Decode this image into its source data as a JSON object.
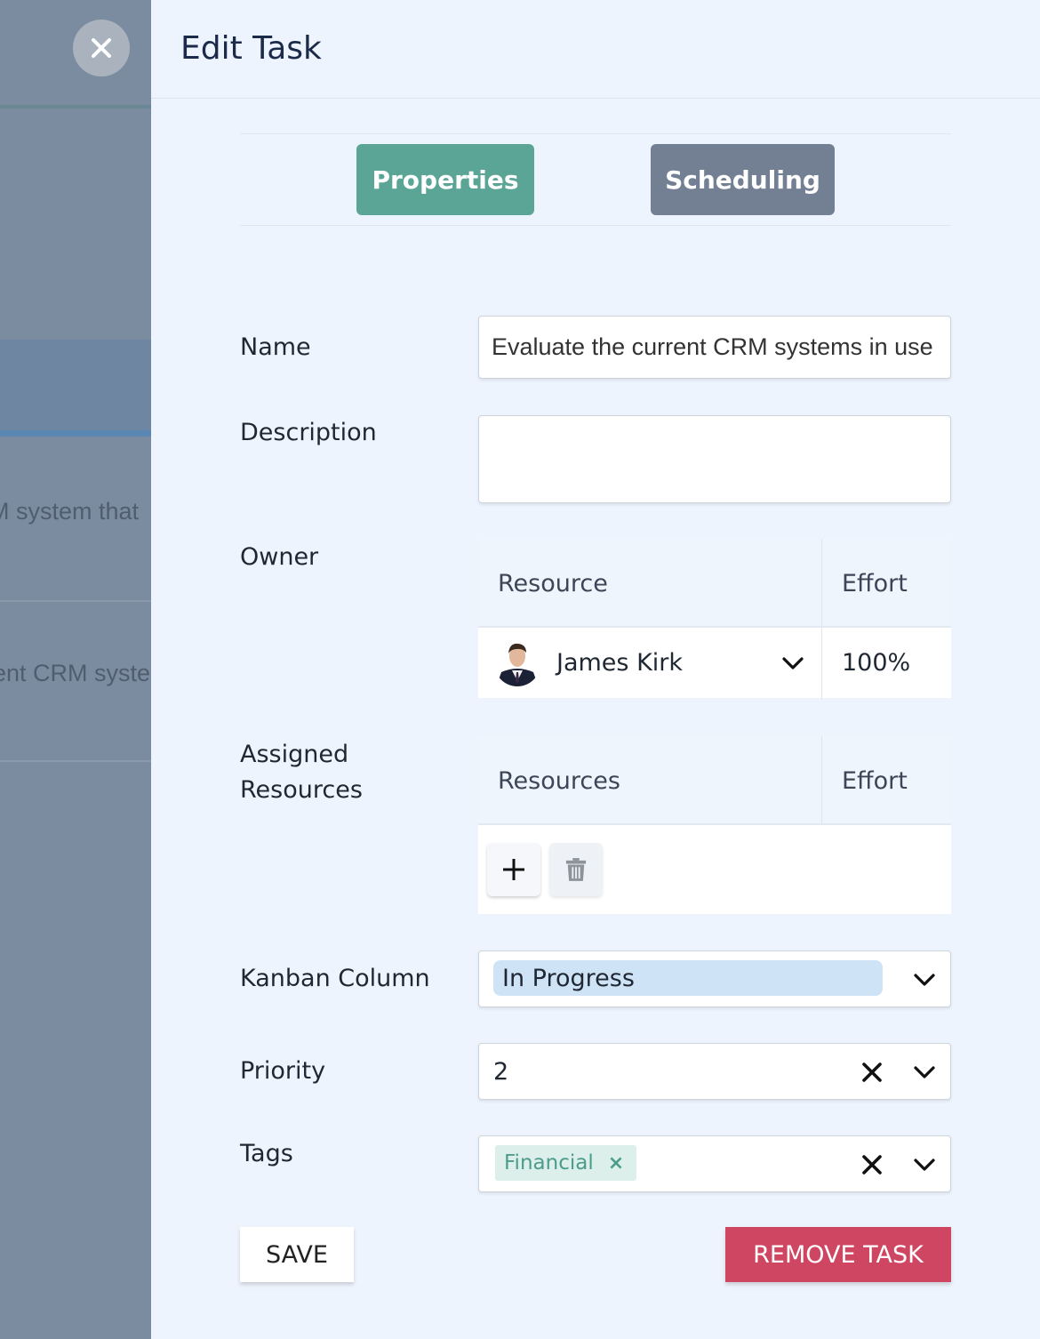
{
  "background": {
    "text_1": "M system that",
    "text_2": "ent CRM syste"
  },
  "panel": {
    "title": "Edit Task"
  },
  "tabs": [
    {
      "label": "Properties",
      "active": true
    },
    {
      "label": "Scheduling",
      "active": false
    }
  ],
  "form": {
    "name_label": "Name",
    "name_value": "Evaluate the current CRM systems in use",
    "description_label": "Description",
    "description_value": "",
    "owner_label": "Owner",
    "owner_grid": {
      "col_resource": "Resource",
      "col_effort": "Effort",
      "row": {
        "name": "James Kirk",
        "effort": "100%"
      }
    },
    "assigned_label": "Assigned Resources",
    "assigned_grid": {
      "col_resources": "Resources",
      "col_effort": "Effort"
    },
    "kanban_label": "Kanban Column",
    "kanban_value": "In Progress",
    "priority_label": "Priority",
    "priority_value": "2",
    "tags_label": "Tags",
    "tags": [
      "Financial"
    ],
    "tag_remove_glyph": "×"
  },
  "buttons": {
    "save": "SAVE",
    "remove": "REMOVE TASK"
  },
  "colors": {
    "tab_active": "#5ba596",
    "tab_inactive": "#737f93",
    "remove_button": "#cf4663",
    "kanban_chip": "#cfe3f7",
    "tag_chip": "#dcefea",
    "panel_bg": "#eef4fd"
  }
}
